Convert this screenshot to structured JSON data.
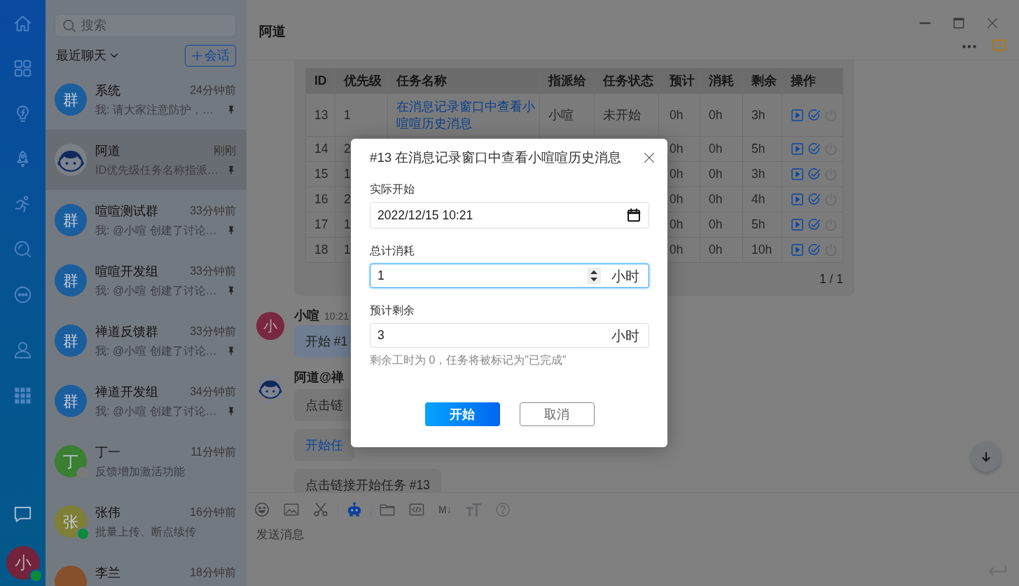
{
  "nav": {
    "top_items": [
      {
        "kind": "home",
        "selected": false
      },
      {
        "kind": "apps",
        "selected": false
      },
      {
        "kind": "bulb",
        "selected": false
      },
      {
        "kind": "rocket",
        "selected": false
      },
      {
        "kind": "runner",
        "selected": false
      },
      {
        "kind": "discover",
        "selected": false
      },
      {
        "kind": "more",
        "selected": false
      }
    ],
    "middle_items": [
      {
        "kind": "contacts",
        "selected": false
      },
      {
        "kind": "grid",
        "selected": false
      }
    ],
    "bottom_items": [
      {
        "kind": "chat",
        "selected": true
      }
    ],
    "user": {
      "avatar": {
        "kind": "text",
        "text": "小",
        "color": "#73233c"
      },
      "status": {
        "color": "#0b8a3e"
      }
    }
  },
  "chat_list": {
    "search": {
      "placeholder": "搜索"
    },
    "filter": {
      "label": "最近聊天"
    },
    "new_button": {
      "label": "会话"
    },
    "chats": [
      {
        "name": "系统",
        "time": "24分钟前",
        "preview": "我: 请大家注意防护，…",
        "pinned": true,
        "selected": false,
        "avatar": {
          "kind": "text",
          "text": "群",
          "color": "#1b5e9e"
        }
      },
      {
        "name": "阿道",
        "time": "刚刚",
        "preview": "ID优先级任务名称指派…",
        "pinned": true,
        "selected": true,
        "avatar": {
          "kind": "robot"
        }
      },
      {
        "name": "喧喧测试群",
        "time": "33分钟前",
        "preview": "我: @小喧 创建了讨论…",
        "pinned": true,
        "selected": false,
        "avatar": {
          "kind": "text",
          "text": "群",
          "color": "#1b5e9e"
        }
      },
      {
        "name": "喧喧开发组",
        "time": "33分钟前",
        "preview": "我: @小喧 创建了讨论…",
        "pinned": true,
        "selected": false,
        "avatar": {
          "kind": "text",
          "text": "群",
          "color": "#1b5e9e"
        }
      },
      {
        "name": "禅道反馈群",
        "time": "33分钟前",
        "preview": "我: @小喧 创建了讨论…",
        "pinned": true,
        "selected": false,
        "avatar": {
          "kind": "text",
          "text": "群",
          "color": "#1b5e9e"
        }
      },
      {
        "name": "禅道开发组",
        "time": "34分钟前",
        "preview": "我: @小喧 创建了讨论…",
        "pinned": true,
        "selected": false,
        "avatar": {
          "kind": "text",
          "text": "群",
          "color": "#1b5e9e"
        }
      },
      {
        "name": "丁一",
        "time": "11分钟前",
        "preview": "反馈增加激活功能",
        "pinned": false,
        "selected": false,
        "avatar": {
          "kind": "text",
          "text": "丁",
          "color": "#3b7f33"
        },
        "status": {
          "color": "#7a7a7a"
        }
      },
      {
        "name": "张伟",
        "time": "16分钟前",
        "preview": "批量上传、断点续传",
        "pinned": false,
        "selected": false,
        "avatar": {
          "kind": "text",
          "text": "张",
          "color": "#7f7f35"
        },
        "status": {
          "color": "#0b8a3e"
        }
      },
      {
        "name": "李兰",
        "time": "18分钟前",
        "pinned": false,
        "selected": false,
        "avatar": {
          "kind": "text",
          "color": "#85502a"
        }
      }
    ]
  },
  "conversation": {
    "title": "阿道",
    "window_controls": [
      {
        "kind": "minimize"
      },
      {
        "kind": "maximize"
      },
      {
        "kind": "close"
      }
    ],
    "actions": [
      {
        "kind": "more"
      },
      {
        "kind": "history"
      }
    ]
  },
  "table": {
    "columns": [
      "ID",
      "优先级",
      "任务名称",
      "指派给",
      "任务状态",
      "预计",
      "消耗",
      "剩余",
      "操作"
    ],
    "rows": [
      {
        "id": "13",
        "priority": "1",
        "name": "在消息记录窗口中查看小喧喧历史消息",
        "assignee": "小喧",
        "status": "未开始",
        "estimate": "0h",
        "consumed": "0h",
        "left": "3h",
        "actions": [
          {
            "kind": "start",
            "disabled": false
          },
          {
            "kind": "finish",
            "disabled": false
          },
          {
            "kind": "close",
            "disabled": true
          }
        ]
      },
      {
        "id": "14",
        "priority": "2",
        "estimate": "0h",
        "consumed": "0h",
        "left": "5h",
        "actions": [
          {
            "kind": "start",
            "disabled": false
          },
          {
            "kind": "finish",
            "disabled": false
          },
          {
            "kind": "close",
            "disabled": true
          }
        ]
      },
      {
        "id": "15",
        "priority": "1",
        "estimate": "0h",
        "consumed": "0h",
        "left": "3h",
        "actions": [
          {
            "kind": "start",
            "disabled": false
          },
          {
            "kind": "finish",
            "disabled": false
          },
          {
            "kind": "close",
            "disabled": true
          }
        ]
      },
      {
        "id": "16",
        "priority": "2",
        "estimate": "0h",
        "consumed": "0h",
        "left": "4h",
        "actions": [
          {
            "kind": "start",
            "disabled": false
          },
          {
            "kind": "finish",
            "disabled": false
          },
          {
            "kind": "close",
            "disabled": true
          }
        ]
      },
      {
        "id": "17",
        "priority": "1",
        "estimate": "0h",
        "consumed": "0h",
        "left": "5h",
        "actions": [
          {
            "kind": "start",
            "disabled": false
          },
          {
            "kind": "finish",
            "disabled": false
          },
          {
            "kind": "close",
            "disabled": true
          }
        ]
      },
      {
        "id": "18",
        "priority": "1",
        "estimate": "0h",
        "consumed": "0h",
        "left": "10h",
        "actions": [
          {
            "kind": "start",
            "disabled": false
          },
          {
            "kind": "finish",
            "disabled": false
          },
          {
            "kind": "close",
            "disabled": true
          }
        ]
      }
    ],
    "pagination": "1 / 1"
  },
  "messages": [
    {
      "sender": "小喧",
      "time": "10:21",
      "mine": true,
      "avatar": {
        "kind": "text",
        "text": "小",
        "color": "#782841"
      },
      "bubbles": [
        {
          "kind": "text",
          "text": "开始 #1"
        }
      ]
    },
    {
      "sender": "阿道@禅",
      "mine": false,
      "avatar": {
        "kind": "robot"
      },
      "bubbles": [
        {
          "kind": "text",
          "text": "点击链"
        },
        {
          "kind": "link",
          "text": "开始任"
        },
        {
          "kind": "text",
          "text": "点击链接开始任务 #13"
        }
      ]
    }
  ],
  "composer": {
    "tools": [
      {
        "kind": "emoji"
      },
      {
        "kind": "image"
      },
      {
        "kind": "scissors"
      },
      {
        "kind": "separator"
      },
      {
        "kind": "robot"
      },
      {
        "kind": "separator"
      },
      {
        "kind": "folder"
      },
      {
        "kind": "code"
      },
      {
        "kind": "markdown",
        "label": "M↓"
      },
      {
        "kind": "text_size"
      },
      {
        "kind": "help"
      }
    ],
    "placeholder": "发送消息"
  },
  "modal": {
    "title": "#13 在消息记录窗口中查看小喧喧历史消息",
    "fields": [
      {
        "kind": "datetime",
        "label": "实际开始",
        "value": "2022/12/15 10:21",
        "focused": false
      },
      {
        "kind": "number",
        "label": "总计消耗",
        "value": "1",
        "unit": "小时",
        "focused": true
      },
      {
        "kind": "number",
        "label": "预计剩余",
        "value": "3",
        "unit": "小时",
        "focused": false,
        "help": "剩余工时为 0，任务将被标记为\"已完成\""
      }
    ],
    "buttons": [
      {
        "kind": "primary",
        "label": "开始"
      },
      {
        "kind": "secondary",
        "label": "取消"
      }
    ]
  }
}
